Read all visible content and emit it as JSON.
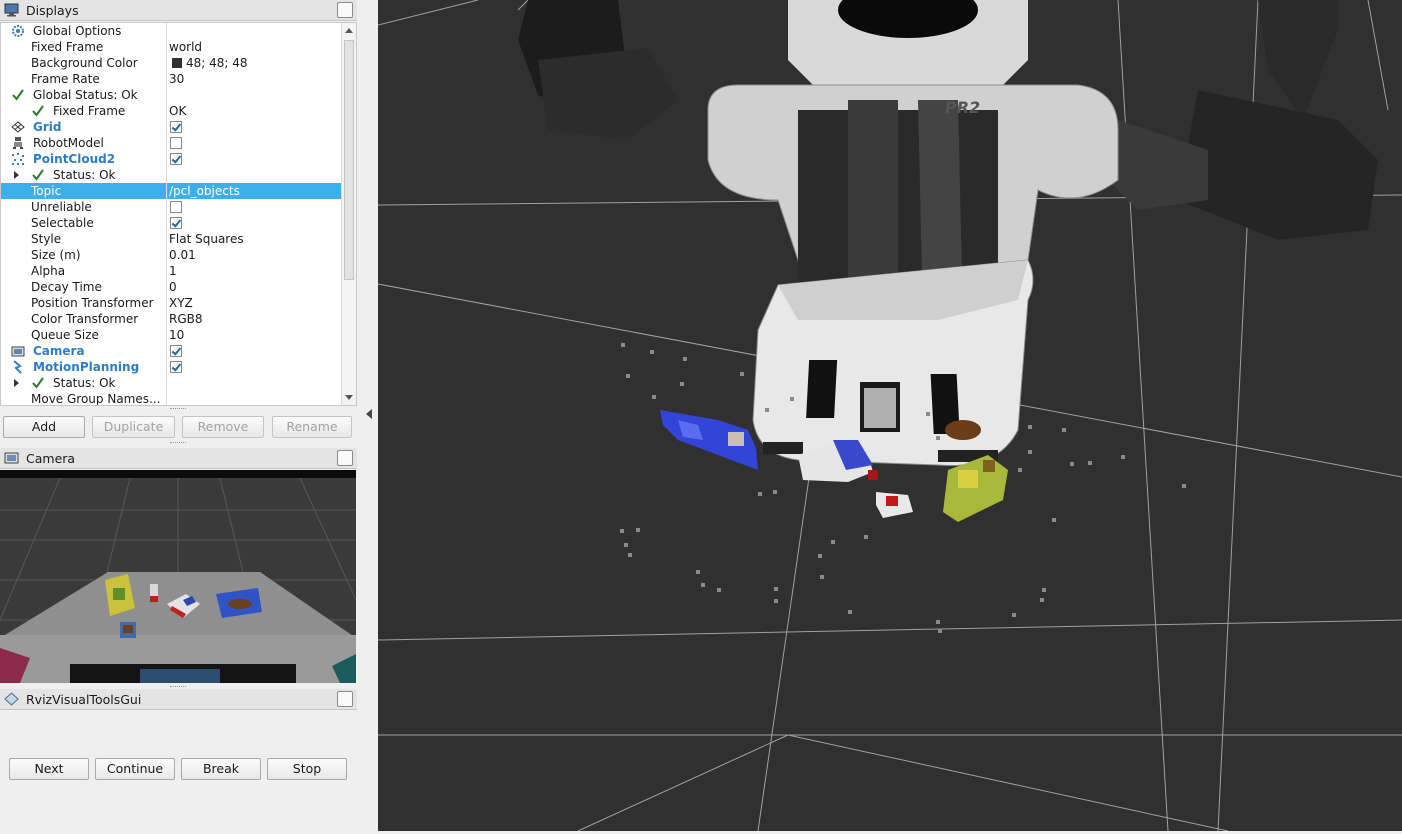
{
  "displays_panel": {
    "title": "Displays",
    "rows": [
      {
        "label": "Global Options",
        "value": "",
        "icon": "gear-icon",
        "indent": 1
      },
      {
        "label": "Fixed Frame",
        "value": "world",
        "indent": 2
      },
      {
        "label": "Background Color",
        "value": "48; 48; 48",
        "swatch": "#303030",
        "indent": 2
      },
      {
        "label": "Frame Rate",
        "value": "30",
        "indent": 2
      },
      {
        "label": "Global Status: Ok",
        "value": "",
        "icon": "check-icon",
        "indent": 1
      },
      {
        "label": "Fixed Frame",
        "value": "OK",
        "icon": "check-icon",
        "indent": 2
      },
      {
        "label": "Grid",
        "value": "",
        "icon": "grid-icon",
        "bold": true,
        "checkbox": true,
        "indent": 1
      },
      {
        "label": "RobotModel",
        "value": "",
        "icon": "robot-icon",
        "checkbox": false,
        "indent": 1
      },
      {
        "label": "PointCloud2",
        "value": "",
        "icon": "pointcloud-icon",
        "bold": true,
        "checkbox": true,
        "indent": 1
      },
      {
        "label": "Status: Ok",
        "value": "",
        "icon": "check-icon",
        "expander": true,
        "indent": 2
      },
      {
        "label": "Topic",
        "value": "/pcl_objects",
        "selected": true,
        "indent": 2
      },
      {
        "label": "Unreliable",
        "value": "",
        "checkbox": false,
        "indent": 2
      },
      {
        "label": "Selectable",
        "value": "",
        "checkbox": true,
        "indent": 2
      },
      {
        "label": "Style",
        "value": "Flat Squares",
        "indent": 2
      },
      {
        "label": "Size (m)",
        "value": "0.01",
        "indent": 2
      },
      {
        "label": "Alpha",
        "value": "1",
        "indent": 2
      },
      {
        "label": "Decay Time",
        "value": "0",
        "indent": 2
      },
      {
        "label": "Position Transformer",
        "value": "XYZ",
        "indent": 2
      },
      {
        "label": "Color Transformer",
        "value": "RGB8",
        "indent": 2
      },
      {
        "label": "Queue Size",
        "value": "10",
        "indent": 2
      },
      {
        "label": "Camera",
        "value": "",
        "icon": "camera-icon",
        "bold": true,
        "checkbox": true,
        "indent": 1
      },
      {
        "label": "MotionPlanning",
        "value": "",
        "icon": "motion-planning-icon",
        "bold": true,
        "checkbox": true,
        "indent": 1
      },
      {
        "label": "Status: Ok",
        "value": "",
        "icon": "check-icon",
        "expander": true,
        "indent": 2
      },
      {
        "label": "Move Group Names...",
        "value": "",
        "indent": 2
      }
    ],
    "buttons": {
      "add": "Add",
      "duplicate": "Duplicate",
      "remove": "Remove",
      "rename": "Rename"
    }
  },
  "camera_panel": {
    "title": "Camera"
  },
  "rviz_visual_tools_panel": {
    "title": "RvizVisualToolsGui",
    "buttons": {
      "next": "Next",
      "continue": "Continue",
      "break": "Break",
      "stop": "Stop"
    }
  },
  "render_view": {
    "background_color": "#303030",
    "robot_label": "PR2"
  },
  "colors": {
    "selection": "#3daee9",
    "bold_display": "#2d7dc6",
    "check": "#2a7a2a"
  }
}
